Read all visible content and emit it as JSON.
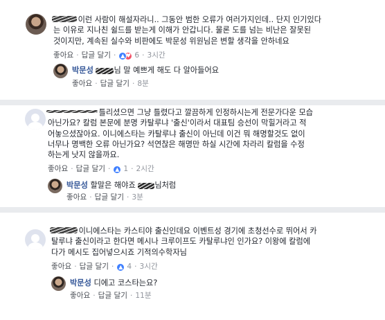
{
  "comments": [
    {
      "author": "",
      "lines": [
        "이런 사람이 해설자라니.. 그동안 범한 오류가 여러가지인데.. 단지 인기있다",
        "는 이유로 지나친 쉴드를 받는게 이해가 안갑니다. 물론 도를 넘는 비난은 잘못된",
        "것이지만, 계속된 실수와 비판에도 박문성 위원님은 변할 생각을 안하네요"
      ],
      "like": "좋아요",
      "reply": "답글 달기",
      "reactions": "6",
      "time": "3시간",
      "reply_item": {
        "author": "박문성",
        "text": "님 말 예쁘게 해도 다 알아들어요",
        "like": "좋아요",
        "reply": "답글 달기",
        "time": "8분"
      }
    },
    {
      "author": "",
      "lines": [
        "틀리셨으면 그냥 틀렸다고 깔끔하게 인정하시는게 전문가다운 모습",
        "아닌가요? 칼럼 본문에 분명 카탈루냐 '출신'이라서 대표팀 승선이 막힐거라고 적",
        "어놓으셨잖아요. 이니에스타는 카탈루냐 출신이 아닌데 이건 뭐 해명할것도 없이",
        "너무나 명백한 오류 아닌가요? 석연찮은 해명만 하실 시간에 차라리 칼럼을 수정",
        "하는게 낫지 않을까요."
      ],
      "like": "좋아요",
      "reply": "답글 달기",
      "reactions": "1",
      "time": "2시간",
      "reply_item": {
        "author": "박문성",
        "text_before": "할말은 해야죠 ",
        "text_after": "님처럼",
        "like": "좋아요",
        "reply": "답글 달기",
        "time": "3분"
      }
    },
    {
      "author": "",
      "lines": [
        "이니에스타는 카스티야 출신인데요 이벤트성 경기에 초청선수로 뛰어서 카",
        "탈루냐 출신이라고 한다면 메시나 크루이프도 카탈루냐인 인가요? 이왕에 칼럼에",
        "다가 메시도 집어넣으시죠 기적의수학자님"
      ],
      "like": "좋아요",
      "reply": "답글 달기",
      "reactions": "4",
      "time": "3시간",
      "reply_item": {
        "author": "박문성",
        "text": "디에고 코스타는요?",
        "like": "좋아요",
        "reply": "답글 달기",
        "time": "11분"
      }
    }
  ],
  "icons": [
    "avatar-photo",
    "avatar-default",
    "like-reaction-icon",
    "love-reaction-icon"
  ],
  "colors": {
    "author": "#365899",
    "meta": "#606770",
    "separator": "#e9ebee",
    "like_blue": "#4080ff",
    "heart_red": "#f25268"
  }
}
